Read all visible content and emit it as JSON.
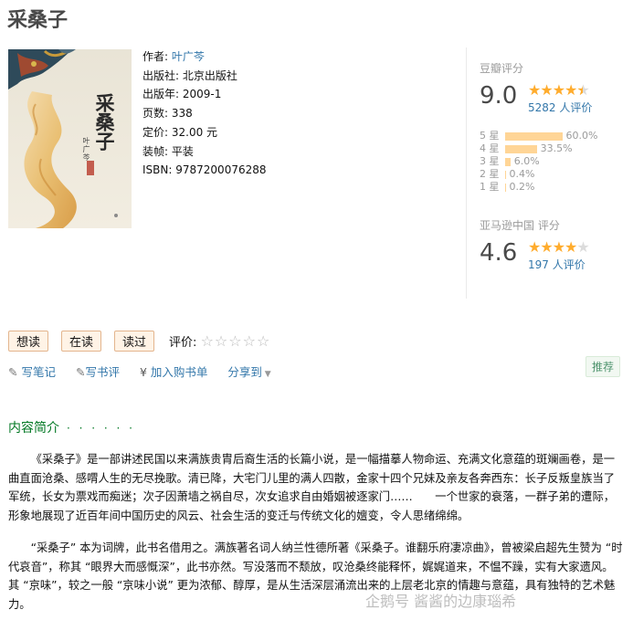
{
  "book": {
    "title": "采桑子",
    "cover_title": "采桑子",
    "cover_author": "叶广芩",
    "author_label": "作者:",
    "author": "叶广芩",
    "publisher_label": "出版社:",
    "publisher": "北京出版社",
    "pubdate_label": "出版年:",
    "pubdate": "2009-1",
    "pages_label": "页数:",
    "pages": "338",
    "price_label": "定价:",
    "price": "32.00 元",
    "binding_label": "装帧:",
    "binding": "平装",
    "isbn_label": "ISBN:",
    "isbn": "9787200076288"
  },
  "douban": {
    "label": "豆瓣评分",
    "score": "9.0",
    "stars": 4.5,
    "count": "5282 人评价",
    "dist": [
      {
        "label": "5 星",
        "pct": "60.0%",
        "value": 60.0
      },
      {
        "label": "4 星",
        "pct": "33.5%",
        "value": 33.5
      },
      {
        "label": "3 星",
        "pct": "6.0%",
        "value": 6.0
      },
      {
        "label": "2 星",
        "pct": "0.4%",
        "value": 0.4
      },
      {
        "label": "1 星",
        "pct": "0.2%",
        "value": 0.2
      }
    ]
  },
  "amazon": {
    "label": "亚马逊中国 评分",
    "score": "4.6",
    "stars": 4.5,
    "count": "197 人评价"
  },
  "actions": {
    "want": "想读",
    "reading": "在读",
    "read": "读过",
    "eval_label": "评价:",
    "note": "写笔记",
    "review": "写书评",
    "cart": "加入购书单",
    "share": "分享到",
    "recommend": "推荐"
  },
  "intro": {
    "title": "内容简介",
    "dots": "· · · · · ·",
    "p1": "《采桑子》是一部讲述民国以来满族贵胄后裔生活的长篇小说，是一幅描摹人物命运、充满文化意蕴的斑斓画卷，是一曲直面沧桑、感喟人生的无尽挽歌。清已降，大宅门儿里的满人四散，金家十四个兄妹及亲友各奔西东：长子反叛皇族当了军统，长女为票戏而痴迷；次子因萧墙之祸自尽，次女追求自由婚姻被逐家门……　　一个世家的衰落，一群子弟的遭际，形象地展现了近百年间中国历史的风云、社会生活的变迁与传统文化的嬗变，令人思绪绵绵。",
    "p2": "“采桑子” 本为词牌，此书名借用之。满族著名词人纳兰性德所著《采桑子。谁翻乐府凄凉曲》，曾被梁启超先生赞为 “时代哀音”，称其 “眼界大而感慨深”，此书亦然。写没落而不颓放，叹沧桑终能释怀，娓娓道来，不愠不躁，实有大家遗风。其 “京味”，较之一般 “京味小说” 更为浓郁、醇厚，是从生活深层涌流出来的上层老北京的情趣与意蕴，具有独特的艺术魅力。"
  },
  "watermark": "企鹅号 酱酱的边康瑙希",
  "colors": {
    "link": "#3377aa",
    "star": "#ffac2d",
    "green": "#007722"
  }
}
